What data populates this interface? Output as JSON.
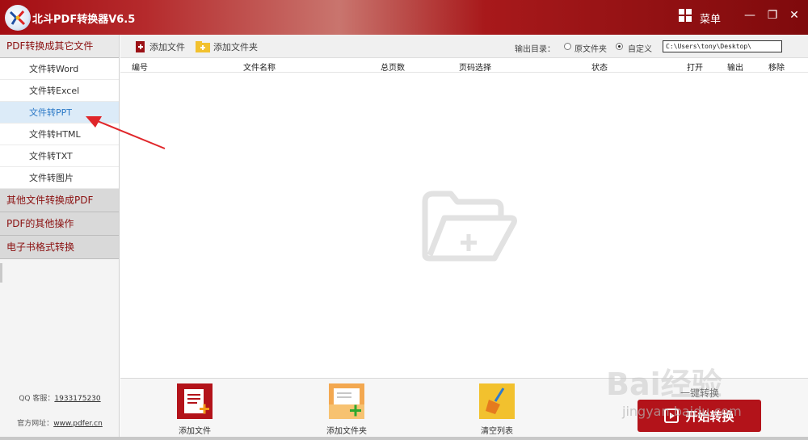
{
  "window": {
    "title": "北斗PDF转换器V6.5",
    "menu_label": "菜单",
    "minimize_icon": "minimize-icon",
    "restore_icon": "restore-icon",
    "close_icon": "close-icon"
  },
  "sidebar": {
    "section1": "PDF转换成其它文件",
    "items": [
      {
        "label": "文件转Word"
      },
      {
        "label": "文件转Excel"
      },
      {
        "label": "文件转PPT",
        "selected": true
      },
      {
        "label": "文件转HTML"
      },
      {
        "label": "文件转TXT"
      },
      {
        "label": "文件转图片"
      }
    ],
    "section2": "其他文件转换成PDF",
    "section3": "PDF的其他操作",
    "section4": "电子书格式转换",
    "qq_label": "QQ 客服：",
    "qq_number": "1933175230",
    "site_label": "官方网址：",
    "site_url": "www.pdfer.cn"
  },
  "toolbar": {
    "add_file": "添加文件",
    "add_folder": "添加文件夹",
    "output_label": "输出目录：",
    "option_original": "原文件夹",
    "option_custom": "自定义",
    "selected_option": "自定义",
    "output_path": "C:\\Users\\tony\\Desktop\\"
  },
  "table": {
    "columns": [
      "编号",
      "文件名称",
      "总页数",
      "页码选择",
      "状态",
      "打开",
      "输出",
      "移除"
    ]
  },
  "bottom": {
    "add_file": "添加文件",
    "add_folder": "添加文件夹",
    "clear_list": "清空列表",
    "start": "开始转换"
  },
  "watermark": {
    "brand": "Bai经验",
    "sub": "jingyan.baidu.com",
    "overlay": "一键转换"
  },
  "colors": {
    "brand_red": "#b3131a",
    "selected_item_bg": "#dcebf8",
    "selected_item_text": "#2a78c6",
    "section_text": "#8b1111"
  }
}
